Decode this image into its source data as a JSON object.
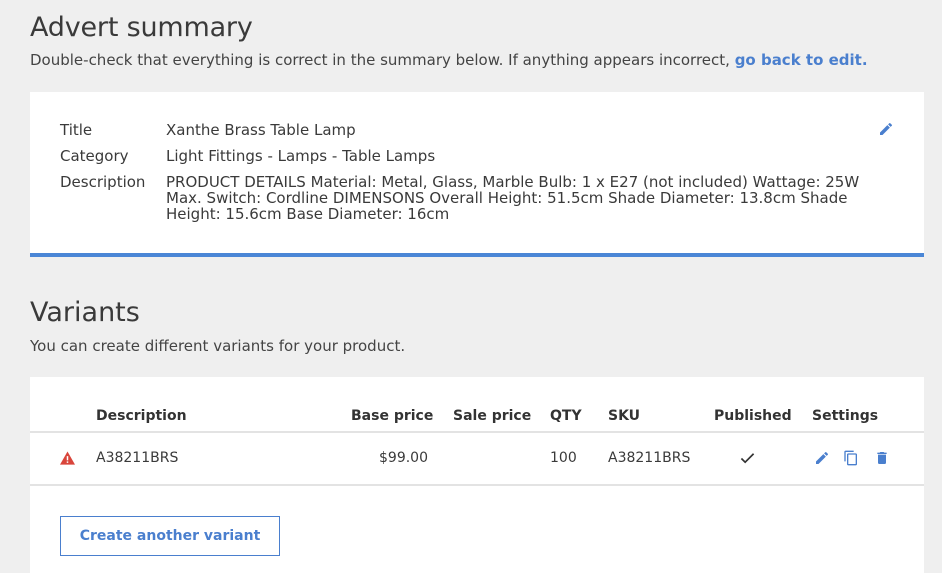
{
  "summary": {
    "heading": "Advert summary",
    "intro_text": "Double-check that everything is correct in the summary below. If anything appears incorrect, ",
    "intro_link": "go back to edit.",
    "fields": {
      "title_label": "Title",
      "title_value": "Xanthe Brass Table Lamp",
      "category_label": "Category",
      "category_value": "Light Fittings - Lamps - Table Lamps",
      "description_label": "Description",
      "description_value": "PRODUCT DETAILS Material: Metal, Glass, Marble Bulb: 1 x E27 (not included) Wattage: 25W Max. Switch: Cordline DIMENSONS Overall Height: 51.5cm Shade Diameter: 13.8cm Shade Height: 15.6cm Base Diameter: 16cm"
    },
    "edit_icon": "pencil-icon"
  },
  "variants": {
    "heading": "Variants",
    "intro_text": "You can create different variants for your product.",
    "columns": {
      "description": "Description",
      "base_price": "Base price",
      "sale_price": "Sale price",
      "qty": "QTY",
      "sku": "SKU",
      "published": "Published",
      "settings": "Settings"
    },
    "rows": [
      {
        "warning_icon": "warning-triangle-icon",
        "description": "A38211BRS",
        "base_price": "$99.00",
        "sale_price": "",
        "qty": "100",
        "sku": "A38211BRS",
        "published_icon": "checkmark-icon",
        "actions": [
          "pencil-icon",
          "copy-icon",
          "trash-icon"
        ]
      }
    ],
    "create_button": "Create another variant"
  },
  "colors": {
    "accent": "#4a7fce",
    "summary_border": "#4a86d6",
    "warning": "#d9453b",
    "background": "#efefef",
    "card": "#ffffff"
  }
}
